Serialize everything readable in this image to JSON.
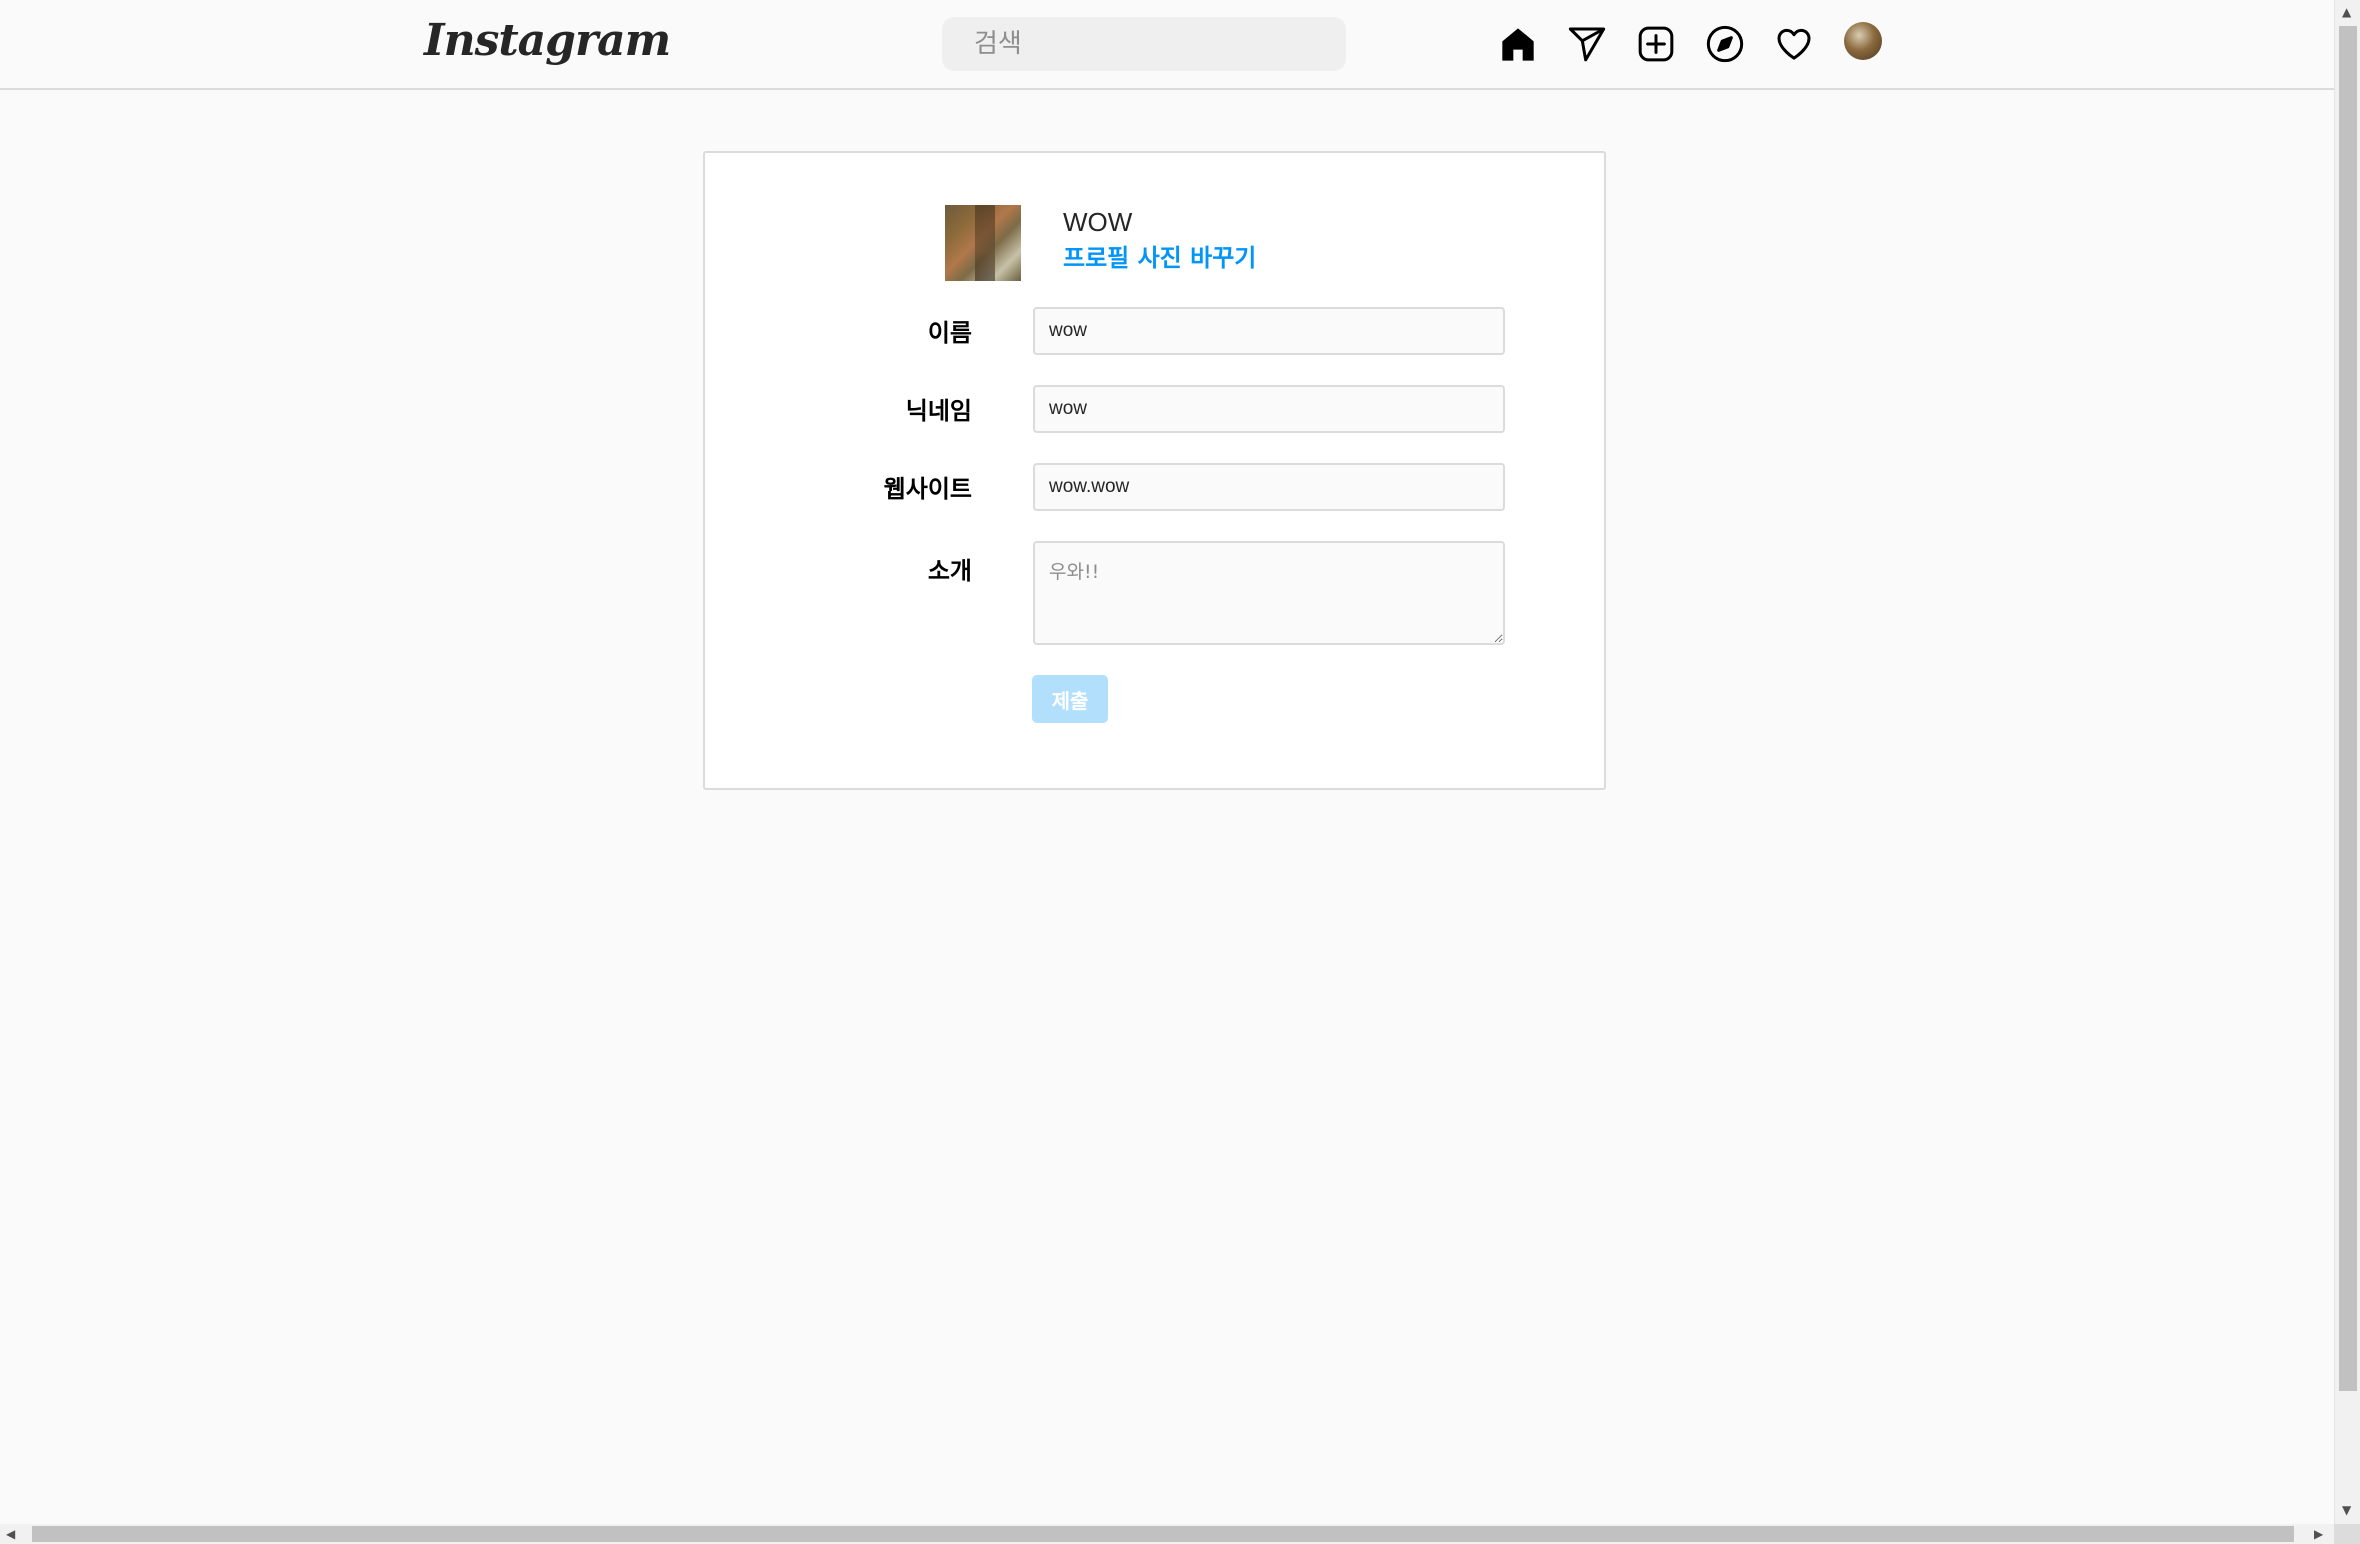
{
  "header": {
    "logo": "Instagram",
    "search_placeholder": "검색",
    "icons": [
      "home-icon",
      "direct-message-icon",
      "new-post-icon",
      "explore-icon",
      "activity-heart-icon",
      "profile-avatar"
    ]
  },
  "profile": {
    "username": "WOW",
    "change_photo": "프로필 사진 바꾸기"
  },
  "form": {
    "name_label": "이름",
    "name_value": "wow",
    "nickname_label": "닉네임",
    "nickname_value": "wow",
    "website_label": "웹사이트",
    "website_value": "wow.wow",
    "bio_label": "소개",
    "bio_value": "우와!!",
    "submit_label": "제출"
  },
  "colors": {
    "accent": "#0095f6",
    "submit_disabled": "#b2dffc",
    "background": "#fafafa",
    "border": "#dbdbdb"
  }
}
